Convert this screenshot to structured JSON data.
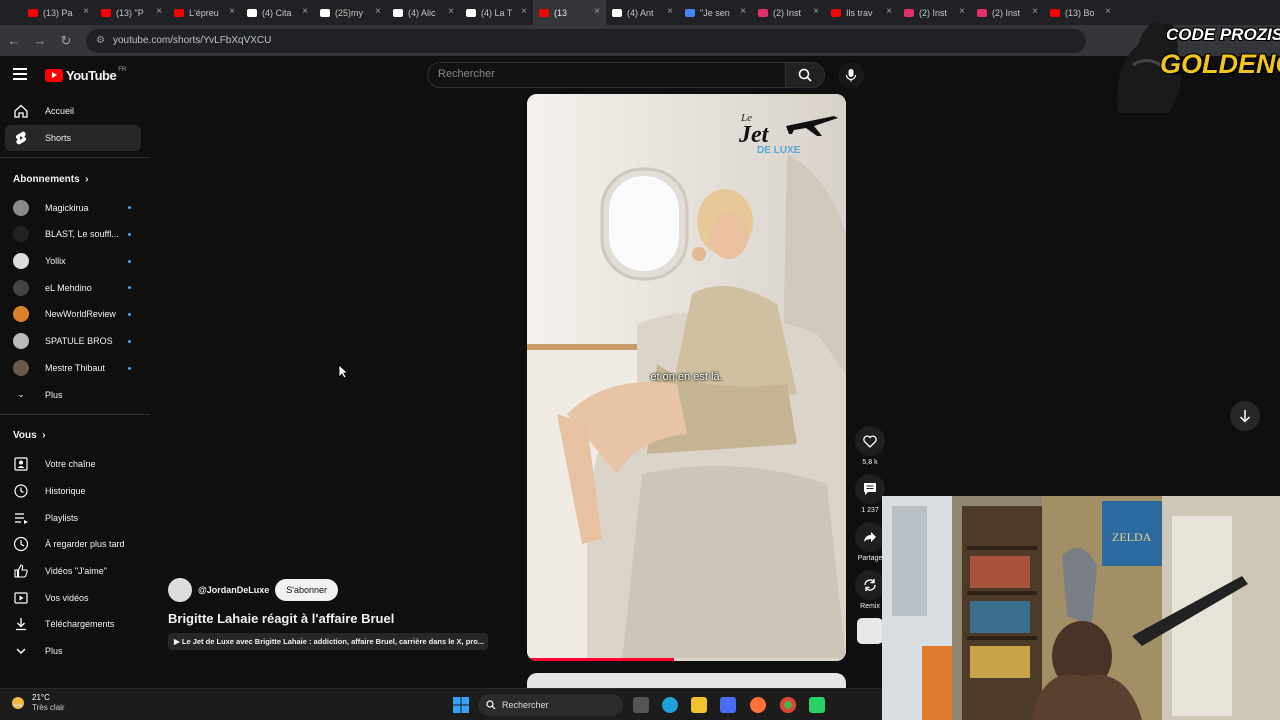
{
  "browser": {
    "tabs": [
      {
        "label": "(13) Pa",
        "icon": "youtube-icon",
        "color": "#ff0000"
      },
      {
        "label": "(13) \"P",
        "icon": "youtube-icon",
        "color": "#ff0000"
      },
      {
        "label": "L'épreu",
        "icon": "youtube-icon",
        "color": "#ff0000"
      },
      {
        "label": "(4) Cita",
        "icon": "x-icon",
        "color": "#ffffff"
      },
      {
        "label": "(25)my",
        "icon": "tiktok-icon",
        "color": "#ffffff"
      },
      {
        "label": "(4) Alic",
        "icon": "x-icon",
        "color": "#ffffff"
      },
      {
        "label": "(4) La T",
        "icon": "x-icon",
        "color": "#ffffff"
      },
      {
        "label": "(13",
        "icon": "youtube-icon",
        "color": "#ff0000",
        "active": true
      },
      {
        "label": "(4) Ant",
        "icon": "x-icon",
        "color": "#ffffff"
      },
      {
        "label": "\"Je sen",
        "icon": "site-icon",
        "color": "#4285f4"
      },
      {
        "label": "(2) Inst",
        "icon": "instagram-icon",
        "color": "#e1306c"
      },
      {
        "label": "Ils trav",
        "icon": "youtube-icon",
        "color": "#ff0000"
      },
      {
        "label": "(2) Inst",
        "icon": "instagram-icon",
        "color": "#e1306c"
      },
      {
        "label": "(2) Inst",
        "icon": "instagram-icon",
        "color": "#e1306c"
      },
      {
        "label": "(13) Bo",
        "icon": "youtube-icon",
        "color": "#ff0000"
      }
    ],
    "url": "youtube.com/shorts/YvLFbXqVXCU"
  },
  "youtube": {
    "logo_text": "YouTube",
    "region": "FR",
    "search_placeholder": "Rechercher"
  },
  "sidebar": {
    "main": [
      {
        "label": "Accueil",
        "icon": "home-icon"
      },
      {
        "label": "Shorts",
        "icon": "shorts-icon",
        "active": true
      }
    ],
    "subscriptions_title": "Abonnements",
    "subscriptions": [
      {
        "label": "Magickirua",
        "color": "#8a8a8a"
      },
      {
        "label": "BLAST, Le souffl...",
        "color": "#222222"
      },
      {
        "label": "Yollix",
        "color": "#dddddd"
      },
      {
        "label": "eL Mehdino",
        "color": "#444444"
      },
      {
        "label": "NewWorldReview",
        "color": "#d9822b"
      },
      {
        "label": "SPATULE BROS",
        "color": "#bbbbbb"
      },
      {
        "label": "Mestre Thibaut",
        "color": "#6b5a48"
      }
    ],
    "more_label": "Plus",
    "you_title": "Vous",
    "you_items": [
      {
        "label": "Votre chaîne",
        "icon": "channel-icon"
      },
      {
        "label": "Historique",
        "icon": "history-icon"
      },
      {
        "label": "Playlists",
        "icon": "playlist-icon"
      },
      {
        "label": "À regarder plus tard",
        "icon": "watch-later-icon"
      },
      {
        "label": "Vidéos \"J'aime\"",
        "icon": "like-icon"
      },
      {
        "label": "Vos vidéos",
        "icon": "video-icon"
      },
      {
        "label": "Téléchargements",
        "icon": "download-icon"
      },
      {
        "label": "Plus",
        "icon": "chevron-down-icon"
      }
    ]
  },
  "short": {
    "caption": "et on en est là.",
    "logo_text_top": "Le",
    "logo_text_main": "Jet",
    "logo_text_sub": "DE LUXE",
    "progress": 0.46,
    "channel": "@JordanDeLuxe",
    "subscribe_label": "S'abonner",
    "title": "Brigitte Lahaie réagit à l'affaire Bruel",
    "related": "Le Jet de Luxe avec Brigitte Lahaie : addiction, affaire Bruel, carrière dans le X, pro..."
  },
  "actions": {
    "likes": "5,8 k",
    "comments": "1 237",
    "share": "Partage",
    "remix": "Remix"
  },
  "taskbar": {
    "temp": "21°C",
    "weather": "Très clair",
    "search": "Rechercher"
  },
  "overlay": {
    "line1": "CODE PROZIS",
    "line2": "GOLDENG"
  }
}
